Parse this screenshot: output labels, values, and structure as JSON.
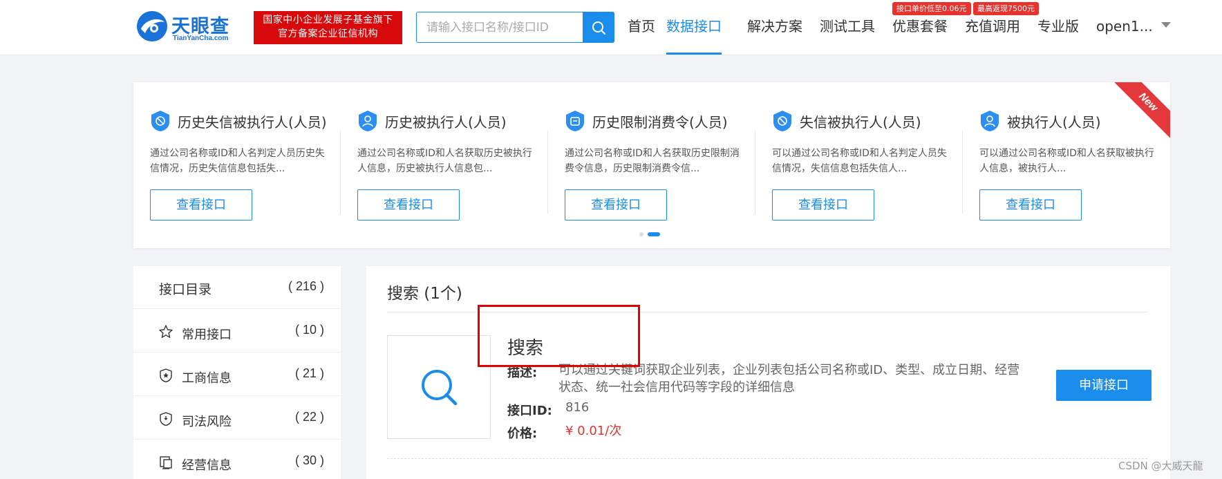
{
  "brand": {
    "name": "天眼查",
    "domain": "TianYanCha.com",
    "gov_badge_line1": "国家中小企业发展子基金旗下",
    "gov_badge_line2": "官方备案企业征信机构"
  },
  "search": {
    "placeholder": "请输入接口名称/接口ID"
  },
  "nav": {
    "items": [
      "首页",
      "数据接口",
      "解决方案",
      "测试工具",
      "优惠套餐",
      "充值调用",
      "专业版",
      "open1..."
    ],
    "active": "数据接口",
    "promo_tags": [
      "接口单价低至0.06元",
      "最高返现7500元"
    ]
  },
  "carousel": {
    "new_ribbon": "New",
    "cards": [
      {
        "title": "历史失信被执行人(人员)",
        "desc": "通过公司名称或ID和人名判定人员历史失信情况，历史失信信息包括失...",
        "button": "查看接口"
      },
      {
        "title": "历史被执行人(人员)",
        "desc": "通过公司名称或ID和人名获取历史被执行人信息，历史被执行人信息包...",
        "button": "查看接口"
      },
      {
        "title": "历史限制消费令(人员)",
        "desc": "通过公司名称或ID和人名获取历史限制消费令信息，历史限制消费令信...",
        "button": "查看接口"
      },
      {
        "title": "失信被执行人(人员)",
        "desc": "可以通过公司名称或ID和人名判定人员失信情况，失信信息包括失信人...",
        "button": "查看接口"
      },
      {
        "title": "被执行人(人员)",
        "desc": "可以通过公司名称或ID和人名获取被执行人信息，被执行人...",
        "button": "查看接口"
      }
    ],
    "active_page": 2,
    "page_count": 2
  },
  "sidebar": {
    "header": {
      "label": "接口目录",
      "count": "( 216 )"
    },
    "items": [
      {
        "label": "常用接口",
        "count": "( 10 )",
        "icon": "star-icon"
      },
      {
        "label": "工商信息",
        "count": "( 21 )",
        "icon": "badge-icon"
      },
      {
        "label": "司法风险",
        "count": "( 22 )",
        "icon": "shield-icon"
      },
      {
        "label": "经营信息",
        "count": "( 30 )",
        "icon": "monitor-icon"
      }
    ]
  },
  "main": {
    "section_title": "搜索 (1个)",
    "api": {
      "name": "搜索",
      "desc_label": "描述:",
      "desc": "可以通过关键词获取企业列表，企业列表包括公司名称或ID、类型、成立日期、经营状态、统一社会信用代码等字段的详细信息",
      "id_label": "接口ID:",
      "id": "816",
      "price_label": "价格:",
      "price": "¥ 0.01/次",
      "apply_button": "申请接口"
    }
  },
  "watermark": "CSDN @大威天龍",
  "colors": {
    "accent": "#1a8ceb",
    "brand_red": "#d7090b",
    "price_red": "#e8322d",
    "annotation_red": "#e00000"
  }
}
